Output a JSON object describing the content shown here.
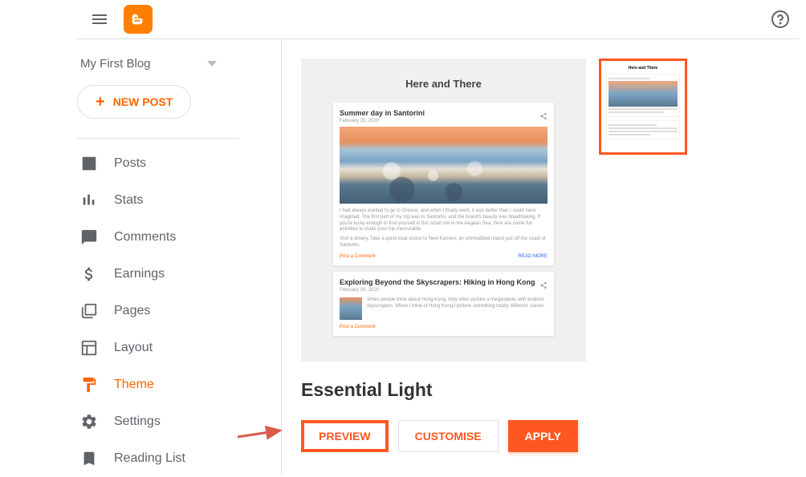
{
  "header": {
    "blog_name": "My First Blog"
  },
  "sidebar": {
    "new_post_label": "NEW POST",
    "items": [
      {
        "label": "Posts",
        "icon": "posts-icon",
        "active": false
      },
      {
        "label": "Stats",
        "icon": "stats-icon",
        "active": false
      },
      {
        "label": "Comments",
        "icon": "comments-icon",
        "active": false
      },
      {
        "label": "Earnings",
        "icon": "earnings-icon",
        "active": false
      },
      {
        "label": "Pages",
        "icon": "pages-icon",
        "active": false
      },
      {
        "label": "Layout",
        "icon": "layout-icon",
        "active": false
      },
      {
        "label": "Theme",
        "icon": "theme-icon",
        "active": true
      },
      {
        "label": "Settings",
        "icon": "settings-icon",
        "active": false
      },
      {
        "label": "Reading List",
        "icon": "reading-list-icon",
        "active": false
      }
    ]
  },
  "main": {
    "preview": {
      "blog_title": "Here and There",
      "posts": [
        {
          "title": "Summer day in Santorini",
          "date": "February 20, 2020",
          "excerpt": "I had always wanted to go to Greece, and when I finally went, it was better than I could have imagined. The first part of my trip was to Santorini, and the island's beauty was breathtaking. If you're lucky enough to find yourself in this small isle in the Aegean Sea, here are some fun activities to make your trip memorable.",
          "bullet": "Visit a winery. Take a quick boat cruise to New Kameni, an uninhabited island just off the coast of Santorini.",
          "comment_label": "Post a Comment",
          "read_more_label": "READ MORE"
        },
        {
          "title": "Exploring Beyond the Skyscrapers: Hiking in Hong Kong",
          "date": "February 20, 2020",
          "excerpt": "When people think about Hong Kong, they often picture a megalopolis with endless skyscrapers. When I think of Hong Kong I picture something totally different: nature.",
          "comment_label": "Post a Comment"
        }
      ]
    },
    "theme_name": "Essential Light",
    "buttons": {
      "preview": "PREVIEW",
      "customise": "CUSTOMISE",
      "apply": "APPLY"
    }
  }
}
